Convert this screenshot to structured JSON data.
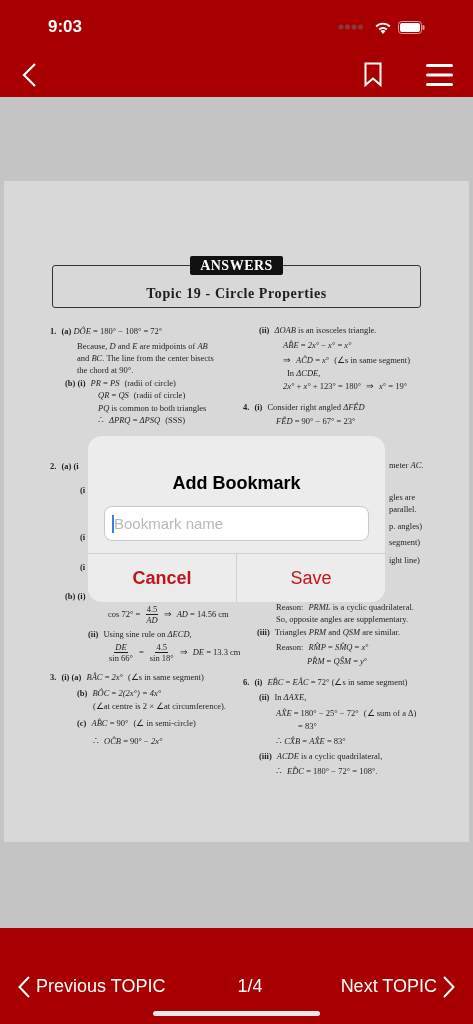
{
  "status_bar": {
    "time": "9:03"
  },
  "document": {
    "badge": "ANSWERS",
    "title": "Topic 19 - Circle Properties",
    "left_column": [
      {
        "segments": [
          {
            "kind": "text",
            "text": "**1.**"
          },
          {
            "kind": "text",
            "text": "**(a)** *DÔE* = 180° − 108° = 72°"
          }
        ]
      },
      {
        "segments": [
          {
            "kind": "text",
            "text": "Because, *D* and *E* are midpoints of *AB*"
          }
        ]
      },
      {
        "segments": [
          {
            "kind": "text",
            "text": "and *BC*. The line from the center bisects"
          }
        ]
      },
      {
        "segments": [
          {
            "kind": "text",
            "text": "the chord at 90°."
          }
        ]
      },
      {
        "segments": [
          {
            "kind": "text",
            "text": "**(b)** **(i)**"
          },
          {
            "kind": "text",
            "text": "*PR* = *PS*"
          },
          {
            "kind": "text",
            "text": "(radii of circle)"
          }
        ]
      },
      {
        "segments": [
          {
            "kind": "text",
            "text": "*QR* = *QS*"
          },
          {
            "kind": "text",
            "text": "(radii of circle)"
          }
        ]
      },
      {
        "segments": [
          {
            "kind": "text",
            "text": "*PQ* is common to both triangles"
          }
        ]
      },
      {
        "segments": [
          {
            "kind": "text",
            "text": "∴"
          },
          {
            "kind": "text",
            "text": "*ΔPRQ* = *ΔPSQ*"
          },
          {
            "kind": "text",
            "text": "(SSS)"
          }
        ]
      },
      {
        "segments": [
          {
            "kind": "text",
            "text": "**2.**"
          },
          {
            "kind": "text",
            "text": "**(a)** **(i**"
          }
        ]
      },
      {
        "segments": [
          {
            "kind": "text",
            "text": "**(i**"
          }
        ]
      },
      {
        "segments": [
          {
            "kind": "text",
            "text": "**(i**"
          }
        ]
      },
      {
        "segments": [
          {
            "kind": "text",
            "text": "**(i**"
          }
        ]
      },
      {
        "segments": [
          {
            "kind": "text",
            "text": "**(b)** **(i)**"
          }
        ]
      },
      {
        "segments": [
          {
            "kind": "text",
            "text": "cos 72° ="
          },
          {
            "kind": "fraction",
            "num": "4.5",
            "den": "*AD*"
          },
          {
            "kind": "text",
            "text": "⇒"
          },
          {
            "kind": "text",
            "text": "*AD* = 14.56 cm"
          }
        ]
      },
      {
        "segments": [
          {
            "kind": "text",
            "text": "**(ii)**"
          },
          {
            "kind": "text",
            "text": "Using sine rule on *ΔECD*,"
          }
        ]
      },
      {
        "segments": [
          {
            "kind": "fraction",
            "num": "*DE*",
            "den": "sin 66°"
          },
          {
            "kind": "text",
            "text": "="
          },
          {
            "kind": "fraction",
            "num": "4.5",
            "den": "sin 18°"
          },
          {
            "kind": "text",
            "text": "⇒"
          },
          {
            "kind": "text",
            "text": "*DE* = 13.3 cm"
          }
        ]
      },
      {
        "segments": [
          {
            "kind": "text",
            "text": "**3.**"
          },
          {
            "kind": "text",
            "text": "**(i)** **(a)**"
          },
          {
            "kind": "text",
            "text": "*BÂC* = *2x°*"
          },
          {
            "kind": "text",
            "text": "(∠s in same segment)"
          }
        ]
      },
      {
        "segments": [
          {
            "kind": "text",
            "text": "**(b)**"
          },
          {
            "kind": "text",
            "text": "*BÔC* = *2(2x°) = 4x°*"
          }
        ]
      },
      {
        "segments": [
          {
            "kind": "text",
            "text": "(∠at centre is 2 × ∠at circumference)."
          }
        ]
      },
      {
        "segments": [
          {
            "kind": "text",
            "text": "**(c)**"
          },
          {
            "kind": "text",
            "text": "*AB̂C* = 90°"
          },
          {
            "kind": "text",
            "text": "(∠ in semi-circle)"
          }
        ]
      },
      {
        "segments": [
          {
            "kind": "text",
            "text": "∴"
          },
          {
            "kind": "text",
            "text": "*OĈB* = 90° − *2x°*"
          }
        ]
      }
    ],
    "right_column": [
      {
        "segments": [
          {
            "kind": "text",
            "text": "**(ii)**"
          },
          {
            "kind": "text",
            "text": "*ΔOAB* is an isosceles triangle."
          }
        ]
      },
      {
        "segments": [
          {
            "kind": "text",
            "text": "*AB̂E* = *2x°* − *x°* = *x°*"
          }
        ]
      },
      {
        "segments": [
          {
            "kind": "text",
            "text": "⇒"
          },
          {
            "kind": "text",
            "text": "*AĈD* = *x*°"
          },
          {
            "kind": "text",
            "text": "(∠s in same segment)"
          }
        ]
      },
      {
        "segments": [
          {
            "kind": "text",
            "text": "In *ΔCDE*,"
          }
        ]
      },
      {
        "segments": [
          {
            "kind": "text",
            "text": "*2x°* + *x°* + 123° = 180°"
          },
          {
            "kind": "text",
            "text": "⇒"
          },
          {
            "kind": "text",
            "text": "*x*° = 19°"
          }
        ]
      },
      {
        "segments": [
          {
            "kind": "text",
            "text": "**4.**"
          },
          {
            "kind": "text",
            "text": "**(i)**"
          },
          {
            "kind": "text",
            "text": "Consider right angled *ΔFÊD*"
          }
        ]
      },
      {
        "segments": [
          {
            "kind": "text",
            "text": "*FÊD* = 90° − 67° = 23°"
          }
        ]
      },
      {
        "segments": [
          {
            "kind": "text",
            "text": "meter *AC*."
          }
        ]
      },
      {
        "segments": [
          {
            "kind": "text",
            "text": "gles are"
          }
        ]
      },
      {
        "segments": [
          {
            "kind": "text",
            "text": "parallel."
          }
        ]
      },
      {
        "segments": [
          {
            "kind": "text",
            "text": "p. angles)"
          }
        ]
      },
      {
        "segments": [
          {
            "kind": "text",
            "text": "segment)"
          }
        ]
      },
      {
        "segments": [
          {
            "kind": "text",
            "text": "ight line)"
          }
        ]
      },
      {
        "segments": [
          {
            "kind": "text",
            "text": "Reason:"
          },
          {
            "kind": "text",
            "text": "*PRML* is a cyclic quadrilateral."
          }
        ]
      },
      {
        "segments": [
          {
            "kind": "text",
            "text": "So, opposite angles are supplementary."
          }
        ]
      },
      {
        "segments": [
          {
            "kind": "text",
            "text": "**(iii)**"
          },
          {
            "kind": "text",
            "text": "Triangles *PRM* and *QSM* are similar."
          }
        ]
      },
      {
        "segments": [
          {
            "kind": "text",
            "text": "Reason:"
          },
          {
            "kind": "text",
            "text": "*RM̂P* = *SM̂Q* = *x*°"
          }
        ]
      },
      {
        "segments": [
          {
            "kind": "text",
            "text": "*PR̂M* = *QŜM* = *y*°"
          }
        ]
      },
      {
        "segments": [
          {
            "kind": "text",
            "text": "**6.**"
          },
          {
            "kind": "text",
            "text": "**(i)**"
          },
          {
            "kind": "text",
            "text": "*EB̂C* = *EÂC* = 72° (∠s in same segment)"
          }
        ]
      },
      {
        "segments": [
          {
            "kind": "text",
            "text": "**(ii)**"
          },
          {
            "kind": "text",
            "text": "In *ΔAXE*,"
          }
        ]
      },
      {
        "segments": [
          {
            "kind": "text",
            "text": "*AX̂E* = 180° − 25° − 72°"
          },
          {
            "kind": "text",
            "text": "(∠ sum of a Δ)"
          }
        ]
      },
      {
        "segments": [
          {
            "kind": "text",
            "text": "= 83°"
          }
        ]
      },
      {
        "segments": [
          {
            "kind": "text",
            "text": "∴ *CX̂B* = *AX̂E* = 83°"
          }
        ]
      },
      {
        "segments": [
          {
            "kind": "text",
            "text": "**(iii)**"
          },
          {
            "kind": "text",
            "text": "*ACDE* is a cyclic quadrilateral,"
          }
        ]
      },
      {
        "segments": [
          {
            "kind": "text",
            "text": "∴"
          },
          {
            "kind": "text",
            "text": "*ED̂C* = 180° − 72° = 108°."
          }
        ]
      }
    ]
  },
  "dialog": {
    "title": "Add Bookmark",
    "field": {
      "placeholder": "Bookmark name"
    },
    "buttons": [
      {
        "label": "Cancel",
        "kind": "cancel"
      },
      {
        "label": "Save",
        "kind": "confirm"
      }
    ]
  },
  "footer": {
    "previous": "Previous TOPIC",
    "page": "1/4",
    "next": "Next TOPIC"
  }
}
